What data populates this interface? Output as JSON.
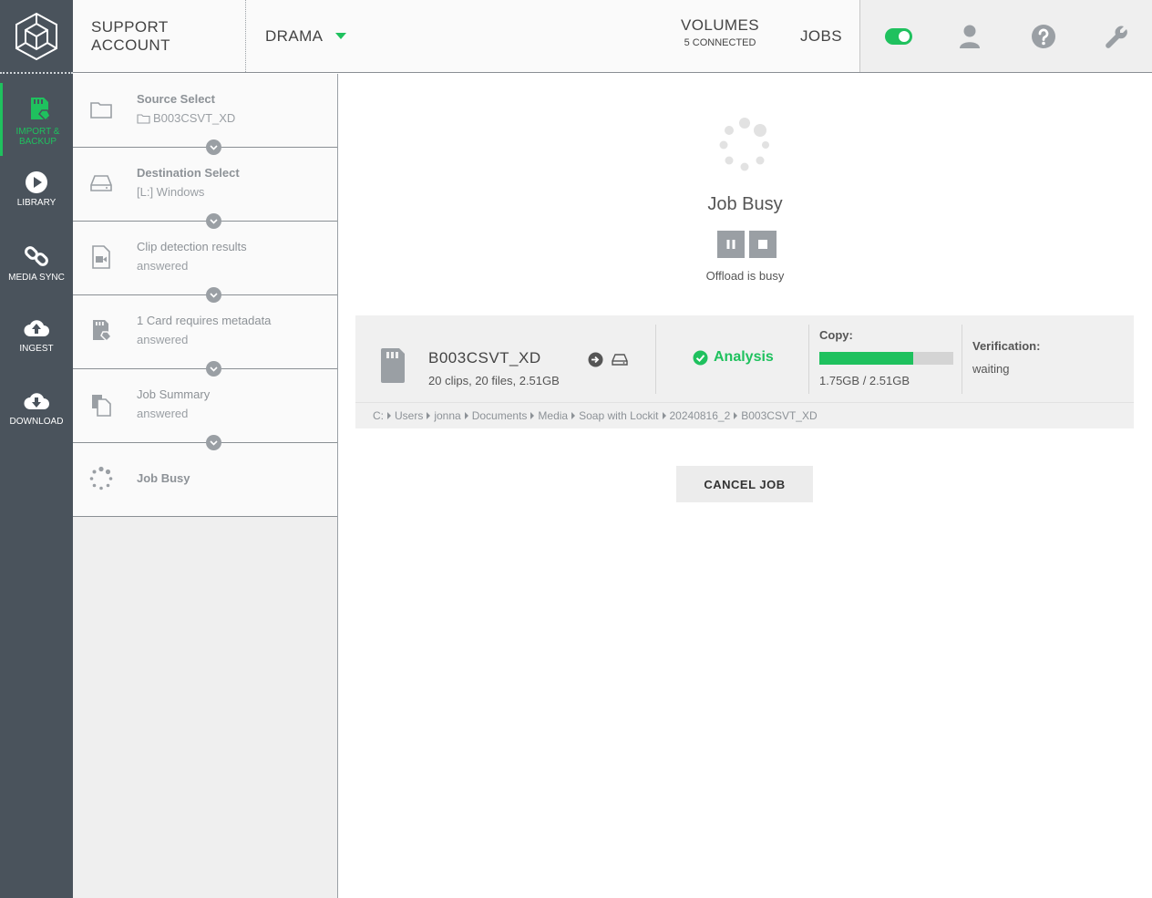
{
  "sidebar": {
    "items": [
      {
        "label": "IMPORT & BACKUP",
        "icon": "sd-card-icon",
        "active": true
      },
      {
        "label": "LIBRARY",
        "icon": "play-icon",
        "active": false
      },
      {
        "label": "MEDIA SYNC",
        "icon": "link-icon",
        "active": false
      },
      {
        "label": "INGEST",
        "icon": "cloud-upload-icon",
        "active": false
      },
      {
        "label": "DOWNLOAD",
        "icon": "cloud-download-icon",
        "active": false
      }
    ]
  },
  "topbar": {
    "account": "SUPPORT ACCOUNT",
    "project": "DRAMA",
    "volumes_label": "VOLUMES",
    "volumes_sub": "5 CONNECTED",
    "jobs_label": "JOBS",
    "icons": [
      "toggle-icon",
      "user-icon",
      "help-icon",
      "wrench-icon"
    ]
  },
  "steps": [
    {
      "title": "Source Select",
      "sub": "B003CSVT_XD",
      "icon": "folder-icon",
      "bold": true
    },
    {
      "title": "Destination Select",
      "sub": "[L:] Windows",
      "icon": "drive-icon",
      "bold": true
    },
    {
      "title": "Clip detection results",
      "sub": "answered",
      "icon": "video-file-icon",
      "bold": false
    },
    {
      "title": "1 Card requires metadata",
      "sub": "answered",
      "icon": "card-tag-icon",
      "bold": false
    },
    {
      "title": "Job Summary",
      "sub": "answered",
      "icon": "summary-icon",
      "bold": false
    },
    {
      "title": "Job Busy",
      "sub": "",
      "icon": "spinner-icon",
      "bold": true
    }
  ],
  "main": {
    "busy_title": "Job Busy",
    "busy_sub": "Offload is busy",
    "card": {
      "name": "B003CSVT_XD",
      "meta": "20 clips, 20 files, 2.51GB",
      "analysis": "Analysis",
      "copy_label": "Copy:",
      "copy_progress": 0.7,
      "copy_size": "1.75GB / 2.51GB",
      "verification_label": "Verification:",
      "verification_value": "waiting",
      "path": [
        "C:",
        "Users",
        "jonna",
        "Documents",
        "Media",
        "Soap with Lockit",
        "20240816_2",
        "B003CSVT_XD"
      ]
    },
    "cancel_label": "CANCEL JOB"
  },
  "colors": {
    "accent": "#1fc15e",
    "sidebar": "#4a535c",
    "muted": "#9a9fa4"
  }
}
